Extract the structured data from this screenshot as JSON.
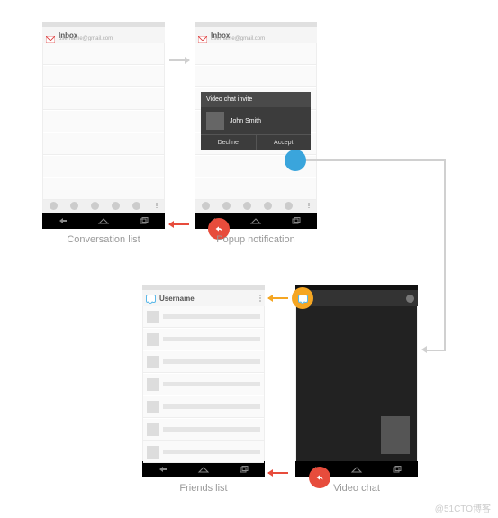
{
  "screens": {
    "conversation": {
      "appTitle": "Inbox",
      "appSub": "username@gmail.com",
      "caption": "Conversation list"
    },
    "popup": {
      "appTitle": "Inbox",
      "appSub": "username@gmail.com",
      "caption": "Popup notification",
      "notifTitle": "Video chat invite",
      "inviter": "John Smith",
      "decline": "Decline",
      "accept": "Accept"
    },
    "friends": {
      "appTitle": "Username",
      "caption": "Friends list"
    },
    "video": {
      "caption": "Video chat"
    }
  },
  "actions": {
    "back": {
      "color": "#e74c3c",
      "icon": "back-icon"
    },
    "accept": {
      "color": "#3aa5dc",
      "icon": "accept-icon"
    },
    "app": {
      "color": "#f5a623",
      "icon": "talk-icon"
    }
  },
  "watermark": "@51CTO博客"
}
